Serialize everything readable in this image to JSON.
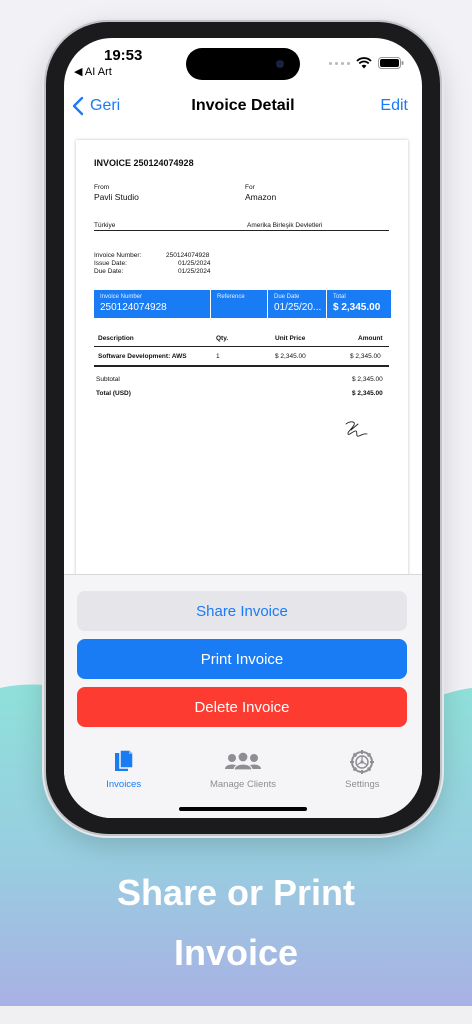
{
  "status_bar": {
    "time": "19:53",
    "back_app": "◀ AI Art"
  },
  "nav": {
    "back_label": "Geri",
    "title": "Invoice Detail",
    "edit_label": "Edit"
  },
  "invoice": {
    "title": "INVOICE 250124074928",
    "from_label": "From",
    "from_name": "Pavli Studio",
    "for_label": "For",
    "for_name": "Amazon",
    "from_country": "Türkiye",
    "for_country": "Amerika Birleşik Devletleri",
    "invoice_number_label": "Invoice Number:",
    "invoice_number": "250124074928",
    "issue_date_label": "Issue Date:",
    "issue_date": "01/25/2024",
    "due_date_label": "Due Date:",
    "due_date": "01/25/2024",
    "band": {
      "invoice_number_label": "Invoice Number",
      "invoice_number": "250124074928",
      "reference_label": "Reference",
      "reference": "",
      "due_date_label": "Due Date",
      "due_date": "01/25/20...",
      "total_label": "Total",
      "total": "$ 2,345.00"
    },
    "table": {
      "headers": {
        "description": "Description",
        "qty": "Qty.",
        "unit_price": "Unit Price",
        "amount": "Amount"
      },
      "rows": [
        {
          "description": "Software Development: AWS",
          "qty": "1",
          "unit_price": "$ 2,345.00",
          "amount": "$ 2,345.00"
        }
      ]
    },
    "subtotal_label": "Subtotal",
    "subtotal": "$ 2,345.00",
    "total_label": "Total (USD)",
    "total": "$ 2,345.00"
  },
  "actions": {
    "share": "Share Invoice",
    "print": "Print Invoice",
    "delete": "Delete Invoice"
  },
  "tabs": [
    {
      "label": "Invoices",
      "icon": "documents-icon",
      "active": true
    },
    {
      "label": "Manage Clients",
      "icon": "people-icon",
      "active": false
    },
    {
      "label": "Settings",
      "icon": "gear-icon",
      "active": false
    }
  ],
  "caption": {
    "line1": "Share or Print",
    "line2": "Invoice"
  },
  "colors": {
    "accent": "#1a7cf5",
    "delete": "#fe3b30",
    "background_top": "#8fe0da",
    "background_bottom": "#a9b1e4"
  }
}
